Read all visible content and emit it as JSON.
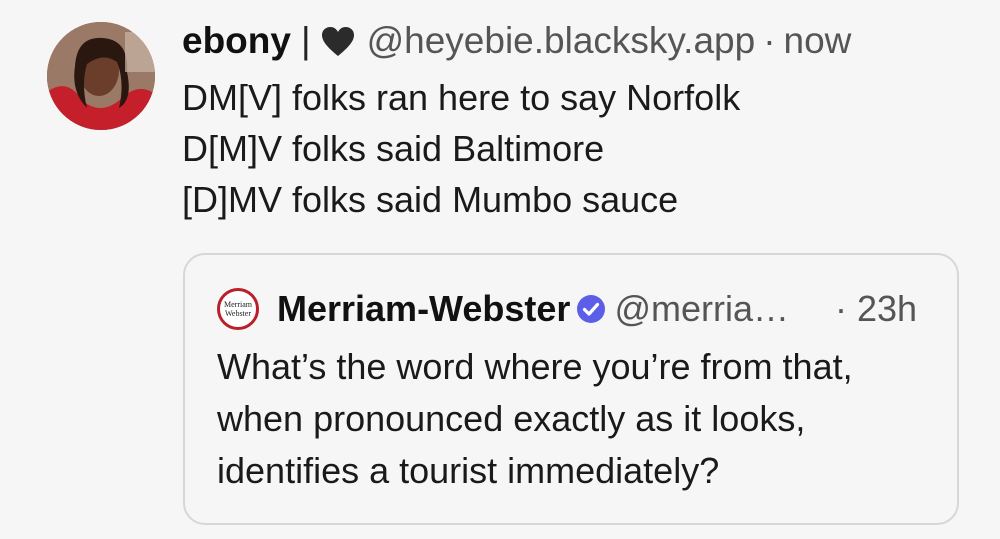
{
  "post": {
    "author_name": "ebony",
    "separator": "|",
    "heart_icon": "black-heart-icon",
    "handle": "@heyebie.blacksky.app",
    "dot": "·",
    "time": "now",
    "body_lines": [
      "DM[V] folks ran here to say Norfolk",
      "D[M]V folks said Baltimore",
      "[D]MV folks said Mumbo sauce"
    ]
  },
  "quote": {
    "logo_icon": "merriam-webster-logo-icon",
    "logo_text_top": "Merriam",
    "logo_text_bottom": "Webster",
    "author_name": "Merriam-Webster",
    "verified_icon": "verified-check-icon",
    "handle": "@merria…",
    "time": "· 23h",
    "body_lines": [
      "What’s the word where you’re from that,",
      "when pronounced exactly as it looks,",
      "identifies a tourist immediately?"
    ]
  },
  "colors": {
    "background": "#f6f6f6",
    "verified": "#5b5ee6",
    "mw_red": "#b8202a",
    "muted_text": "#555555"
  }
}
